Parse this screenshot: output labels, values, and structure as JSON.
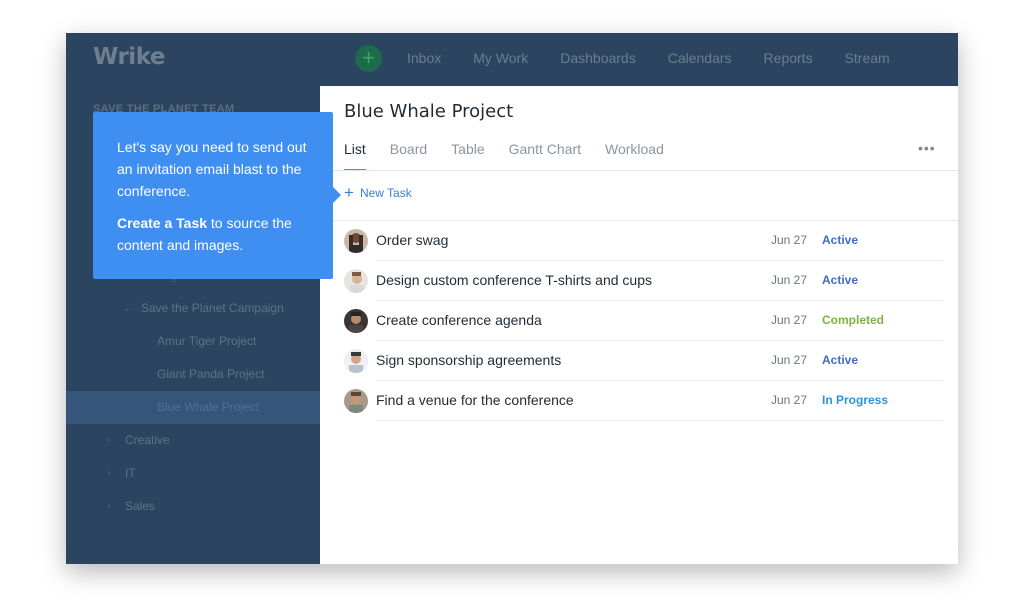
{
  "app": {
    "logo": "Wrike"
  },
  "topnav": {
    "add_label": "+",
    "items": [
      "Inbox",
      "My Work",
      "Dashboards",
      "Calendars",
      "Reports",
      "Stream"
    ]
  },
  "sidebar": {
    "team_title": "SAVE THE PLANET TEAM",
    "ghost_fragment": "g",
    "campaign": "Save the Planet Campaign",
    "projects": [
      "Amur Tiger Project",
      "Giant Panda Project",
      "Blue Whale Project"
    ],
    "folders": [
      "Creative",
      "IT",
      "Sales"
    ]
  },
  "panel": {
    "title": "Blue Whale Project",
    "tabs": [
      "List",
      "Board",
      "Table",
      "Gantt Chart",
      "Workload"
    ],
    "more_label": "•••",
    "new_task": "New Task",
    "tasks": [
      {
        "name": "Order swag",
        "date": "Jun 27",
        "status": "Active",
        "status_color": "#3c6fc4"
      },
      {
        "name": "Design custom conference T-shirts and cups",
        "date": "Jun 27",
        "status": "Active",
        "status_color": "#3c6fc4"
      },
      {
        "name": "Create conference agenda",
        "date": "Jun 27",
        "status": "Completed",
        "status_color": "#7cb342"
      },
      {
        "name": "Sign sponsorship agreements",
        "date": "Jun 27",
        "status": "Active",
        "status_color": "#3c6fc4"
      },
      {
        "name": "Find a venue for the conference",
        "date": "Jun 27",
        "status": "In Progress",
        "status_color": "#2b95d9"
      }
    ]
  },
  "tooltip": {
    "line1": "Let's say you need to send out an invitation email blast to the conference.",
    "bold": "Create a Task",
    "rest": " to source the content and images."
  },
  "colors": {
    "accent": "#3f8ef2",
    "nav_bg": "#2b4560"
  }
}
